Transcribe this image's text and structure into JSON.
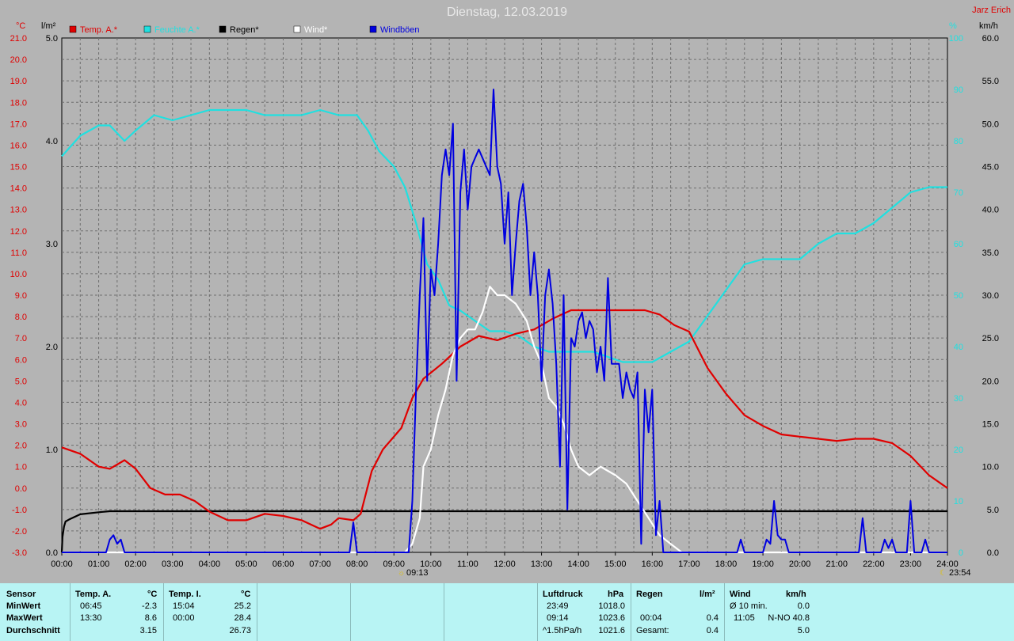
{
  "chart_data": {
    "type": "line",
    "title": "Dienstag, 12.03.2019",
    "author": "Jarz Erich",
    "left_axis": {
      "unit": "°C",
      "min": -3,
      "max": 21,
      "step": 1
    },
    "rain_axis": {
      "unit": "l/m²",
      "min": 0,
      "max": 5,
      "ticks": [
        "0.0",
        "1.0",
        "2.0",
        "3.0",
        "4.0",
        "5.0"
      ]
    },
    "humidity_axis": {
      "unit": "%",
      "min": 0,
      "max": 100,
      "step": 10
    },
    "wind_axis": {
      "unit": "km/h",
      "min": 0,
      "max": 60,
      "step": 5
    },
    "x_ticks": [
      "00:00",
      "01:00",
      "02:00",
      "03:00",
      "04:00",
      "05:00",
      "06:00",
      "07:00",
      "08:00",
      "09:00",
      "10:00",
      "11:00",
      "12:00",
      "13:00",
      "14:00",
      "15:00",
      "16:00",
      "17:00",
      "18:00",
      "19:00",
      "20:00",
      "21:00",
      "22:00",
      "23:00",
      "24:00"
    ],
    "sunrise": "09:13",
    "sunset": "23:54",
    "grid": true,
    "legend": [
      {
        "label": "Temp. A.*",
        "color": "#e00000"
      },
      {
        "label": "Feuchte A.*",
        "color": "#20e0e0"
      },
      {
        "label": "Regen*",
        "color": "#000000"
      },
      {
        "label": "Wind*",
        "color": "#ffffff"
      },
      {
        "label": "Windböen",
        "color": "#0000e0"
      }
    ],
    "series": [
      {
        "name": "Temp. A.*",
        "axis": "temp",
        "color": "#e00000",
        "points": [
          [
            0,
            1.9
          ],
          [
            0.5,
            1.6
          ],
          [
            1,
            1.0
          ],
          [
            1.3,
            0.9
          ],
          [
            1.7,
            1.3
          ],
          [
            2,
            0.9
          ],
          [
            2.4,
            0.0
          ],
          [
            2.8,
            -0.3
          ],
          [
            3.2,
            -0.3
          ],
          [
            3.6,
            -0.6
          ],
          [
            4,
            -1.1
          ],
          [
            4.5,
            -1.5
          ],
          [
            5,
            -1.5
          ],
          [
            5.5,
            -1.2
          ],
          [
            6,
            -1.3
          ],
          [
            6.5,
            -1.5
          ],
          [
            7,
            -1.9
          ],
          [
            7.3,
            -1.7
          ],
          [
            7.5,
            -1.4
          ],
          [
            7.9,
            -1.5
          ],
          [
            8.1,
            -1.2
          ],
          [
            8.4,
            0.8
          ],
          [
            8.7,
            1.8
          ],
          [
            9.2,
            2.8
          ],
          [
            9.5,
            4.2
          ],
          [
            9.8,
            5.1
          ],
          [
            10.3,
            5.8
          ],
          [
            10.8,
            6.6
          ],
          [
            11.3,
            7.1
          ],
          [
            11.8,
            6.9
          ],
          [
            12.3,
            7.2
          ],
          [
            12.8,
            7.4
          ],
          [
            13.3,
            7.9
          ],
          [
            13.8,
            8.3
          ],
          [
            14.3,
            8.3
          ],
          [
            14.8,
            8.3
          ],
          [
            15.3,
            8.3
          ],
          [
            15.8,
            8.3
          ],
          [
            16.2,
            8.1
          ],
          [
            16.6,
            7.6
          ],
          [
            17.0,
            7.3
          ],
          [
            17.5,
            5.6
          ],
          [
            18,
            4.4
          ],
          [
            18.5,
            3.4
          ],
          [
            19,
            2.9
          ],
          [
            19.5,
            2.5
          ],
          [
            20,
            2.4
          ],
          [
            20.5,
            2.3
          ],
          [
            21,
            2.2
          ],
          [
            21.5,
            2.3
          ],
          [
            22,
            2.3
          ],
          [
            22.5,
            2.1
          ],
          [
            23,
            1.5
          ],
          [
            23.5,
            0.6
          ],
          [
            24,
            0.0
          ]
        ]
      },
      {
        "name": "Feuchte A.*",
        "axis": "humidity",
        "color": "#20e0e0",
        "points": [
          [
            0,
            77
          ],
          [
            0.5,
            81
          ],
          [
            1,
            83
          ],
          [
            1.3,
            83
          ],
          [
            1.7,
            80
          ],
          [
            2,
            82
          ],
          [
            2.5,
            85
          ],
          [
            3,
            84
          ],
          [
            3.5,
            85
          ],
          [
            4,
            86
          ],
          [
            4.5,
            86
          ],
          [
            5,
            86
          ],
          [
            5.5,
            85
          ],
          [
            6,
            85
          ],
          [
            6.5,
            85
          ],
          [
            7,
            86
          ],
          [
            7.5,
            85
          ],
          [
            8,
            85
          ],
          [
            8.3,
            82
          ],
          [
            8.6,
            78
          ],
          [
            9,
            75
          ],
          [
            9.3,
            71
          ],
          [
            9.6,
            64
          ],
          [
            9.9,
            56
          ],
          [
            10.2,
            53
          ],
          [
            10.5,
            48
          ],
          [
            10.8,
            47
          ],
          [
            11.2,
            45
          ],
          [
            11.6,
            43
          ],
          [
            12,
            43
          ],
          [
            12.4,
            42
          ],
          [
            12.8,
            40
          ],
          [
            13.2,
            39
          ],
          [
            13.6,
            39
          ],
          [
            14,
            39
          ],
          [
            14.4,
            39
          ],
          [
            14.8,
            38
          ],
          [
            15.2,
            37
          ],
          [
            15.6,
            37
          ],
          [
            16,
            37
          ],
          [
            16.5,
            39
          ],
          [
            17,
            41
          ],
          [
            17.5,
            46
          ],
          [
            18,
            51
          ],
          [
            18.5,
            56
          ],
          [
            19,
            57
          ],
          [
            19.5,
            57
          ],
          [
            20,
            57
          ],
          [
            20.5,
            60
          ],
          [
            21,
            62
          ],
          [
            21.5,
            62
          ],
          [
            22,
            64
          ],
          [
            22.5,
            67
          ],
          [
            23,
            70
          ],
          [
            23.5,
            71
          ],
          [
            24,
            71
          ]
        ]
      },
      {
        "name": "Regen*",
        "axis": "rain",
        "color": "#000000",
        "points": [
          [
            0.0,
            0
          ],
          [
            0.02,
            0.15
          ],
          [
            0.06,
            0.25
          ],
          [
            0.1,
            0.3
          ],
          [
            0.2,
            0.32
          ],
          [
            0.5,
            0.37
          ],
          [
            1,
            0.39
          ],
          [
            1.3,
            0.4
          ],
          [
            24,
            0.4
          ]
        ]
      },
      {
        "name": "Wind*",
        "axis": "wind",
        "color": "#ffffff",
        "points": [
          [
            0,
            0
          ],
          [
            9.3,
            0
          ],
          [
            9.5,
            1
          ],
          [
            9.7,
            4
          ],
          [
            9.8,
            10
          ],
          [
            10,
            12
          ],
          [
            10.2,
            16
          ],
          [
            10.4,
            19
          ],
          [
            10.6,
            23
          ],
          [
            10.8,
            25
          ],
          [
            11,
            26
          ],
          [
            11.2,
            26
          ],
          [
            11.4,
            28
          ],
          [
            11.6,
            31
          ],
          [
            11.8,
            30
          ],
          [
            12,
            30
          ],
          [
            12.3,
            29
          ],
          [
            12.6,
            27
          ],
          [
            12.8,
            24
          ],
          [
            13,
            22
          ],
          [
            13.2,
            18
          ],
          [
            13.4,
            17
          ],
          [
            13.6,
            15
          ],
          [
            13.8,
            12
          ],
          [
            14,
            10
          ],
          [
            14.3,
            9
          ],
          [
            14.6,
            10
          ],
          [
            15,
            9
          ],
          [
            15.3,
            8
          ],
          [
            15.6,
            6
          ],
          [
            15.9,
            4
          ],
          [
            16.2,
            2
          ],
          [
            16.5,
            1
          ],
          [
            16.8,
            0
          ],
          [
            24,
            0
          ]
        ]
      },
      {
        "name": "Windböen",
        "axis": "wind",
        "color": "#0000e0",
        "points": [
          [
            0,
            0
          ],
          [
            1.2,
            0
          ],
          [
            1.3,
            1.5
          ],
          [
            1.4,
            2
          ],
          [
            1.5,
            1
          ],
          [
            1.6,
            1.5
          ],
          [
            1.7,
            0
          ],
          [
            7.8,
            0
          ],
          [
            7.9,
            3.5
          ],
          [
            8.0,
            0
          ],
          [
            9.4,
            0
          ],
          [
            9.5,
            6
          ],
          [
            9.6,
            19
          ],
          [
            9.7,
            30
          ],
          [
            9.8,
            39
          ],
          [
            9.9,
            20
          ],
          [
            10.0,
            33
          ],
          [
            10.1,
            30
          ],
          [
            10.2,
            36
          ],
          [
            10.3,
            44
          ],
          [
            10.4,
            47
          ],
          [
            10.5,
            44
          ],
          [
            10.6,
            50
          ],
          [
            10.7,
            20
          ],
          [
            10.8,
            42
          ],
          [
            10.9,
            47
          ],
          [
            11.0,
            40
          ],
          [
            11.1,
            45
          ],
          [
            11.2,
            46
          ],
          [
            11.3,
            47
          ],
          [
            11.4,
            46
          ],
          [
            11.5,
            45
          ],
          [
            11.6,
            44
          ],
          [
            11.7,
            54
          ],
          [
            11.8,
            45
          ],
          [
            11.9,
            43
          ],
          [
            12.0,
            36
          ],
          [
            12.1,
            42
          ],
          [
            12.2,
            30
          ],
          [
            12.3,
            36
          ],
          [
            12.4,
            41
          ],
          [
            12.5,
            43
          ],
          [
            12.6,
            38
          ],
          [
            12.7,
            30
          ],
          [
            12.8,
            35
          ],
          [
            12.9,
            30
          ],
          [
            13.0,
            20
          ],
          [
            13.1,
            30
          ],
          [
            13.2,
            33
          ],
          [
            13.3,
            29
          ],
          [
            13.4,
            22
          ],
          [
            13.5,
            10
          ],
          [
            13.6,
            30
          ],
          [
            13.7,
            5
          ],
          [
            13.8,
            25
          ],
          [
            13.9,
            24
          ],
          [
            14.0,
            27
          ],
          [
            14.1,
            28
          ],
          [
            14.2,
            25
          ],
          [
            14.3,
            27
          ],
          [
            14.4,
            26
          ],
          [
            14.5,
            21
          ],
          [
            14.6,
            24
          ],
          [
            14.7,
            20
          ],
          [
            14.8,
            32
          ],
          [
            14.9,
            22
          ],
          [
            15.0,
            22
          ],
          [
            15.1,
            22
          ],
          [
            15.2,
            18
          ],
          [
            15.3,
            21
          ],
          [
            15.4,
            19
          ],
          [
            15.5,
            18
          ],
          [
            15.6,
            21
          ],
          [
            15.7,
            1
          ],
          [
            15.8,
            19
          ],
          [
            15.9,
            14
          ],
          [
            16.0,
            19
          ],
          [
            16.1,
            2
          ],
          [
            16.2,
            6
          ],
          [
            16.3,
            0
          ],
          [
            18.3,
            0
          ],
          [
            18.4,
            1.5
          ],
          [
            18.5,
            0
          ],
          [
            19.0,
            0
          ],
          [
            19.1,
            1.5
          ],
          [
            19.2,
            1
          ],
          [
            19.3,
            6
          ],
          [
            19.4,
            2
          ],
          [
            19.5,
            1.5
          ],
          [
            19.6,
            1.5
          ],
          [
            19.7,
            0
          ],
          [
            21.6,
            0
          ],
          [
            21.7,
            4
          ],
          [
            21.8,
            0
          ],
          [
            22.2,
            0
          ],
          [
            22.3,
            1.5
          ],
          [
            22.4,
            0.5
          ],
          [
            22.5,
            1.5
          ],
          [
            22.6,
            0
          ],
          [
            22.9,
            0
          ],
          [
            23.0,
            6
          ],
          [
            23.1,
            0
          ],
          [
            23.3,
            0
          ],
          [
            23.4,
            1.5
          ],
          [
            23.5,
            0
          ],
          [
            24,
            0
          ]
        ]
      }
    ]
  },
  "stats": {
    "headers": {
      "sensor": "Sensor",
      "temp_a": "Temp. A.",
      "temp_a_unit": "°C",
      "temp_i": "Temp. I.",
      "temp_i_unit": "°C",
      "pressure": "Luftdruck",
      "pressure_unit": "hPa",
      "rain": "Regen",
      "rain_unit": "l/m²",
      "wind": "Wind",
      "wind_unit": "km/h"
    },
    "rows": {
      "min_label": "MinWert",
      "max_label": "MaxWert",
      "avg_label": "Durchschnitt"
    },
    "temp_a": {
      "min_time": "06:45",
      "min_val": "-2.3",
      "max_time": "13:30",
      "max_val": "8.6",
      "avg": "3.15"
    },
    "temp_i": {
      "min_time": "15:04",
      "min_val": "25.2",
      "max_time": "00:00",
      "max_val": "28.4",
      "avg": "26.73"
    },
    "pressure": {
      "min_time": "23:49",
      "min_val": "1018.0",
      "max_time": "09:14",
      "max_val": "1023.6",
      "trend_label": "^1.5hPa/h",
      "trend_val": "1021.6"
    },
    "rain": {
      "time": "00:04",
      "val": "0.4",
      "total_label": "Gesamt:",
      "total_val": "0.4"
    },
    "wind": {
      "avg_label": "Ø 10 min.",
      "avg_val": "0.0",
      "max_time": "11:05",
      "max_val": "N-NO 40.8",
      "mean_val": "5.0"
    }
  }
}
